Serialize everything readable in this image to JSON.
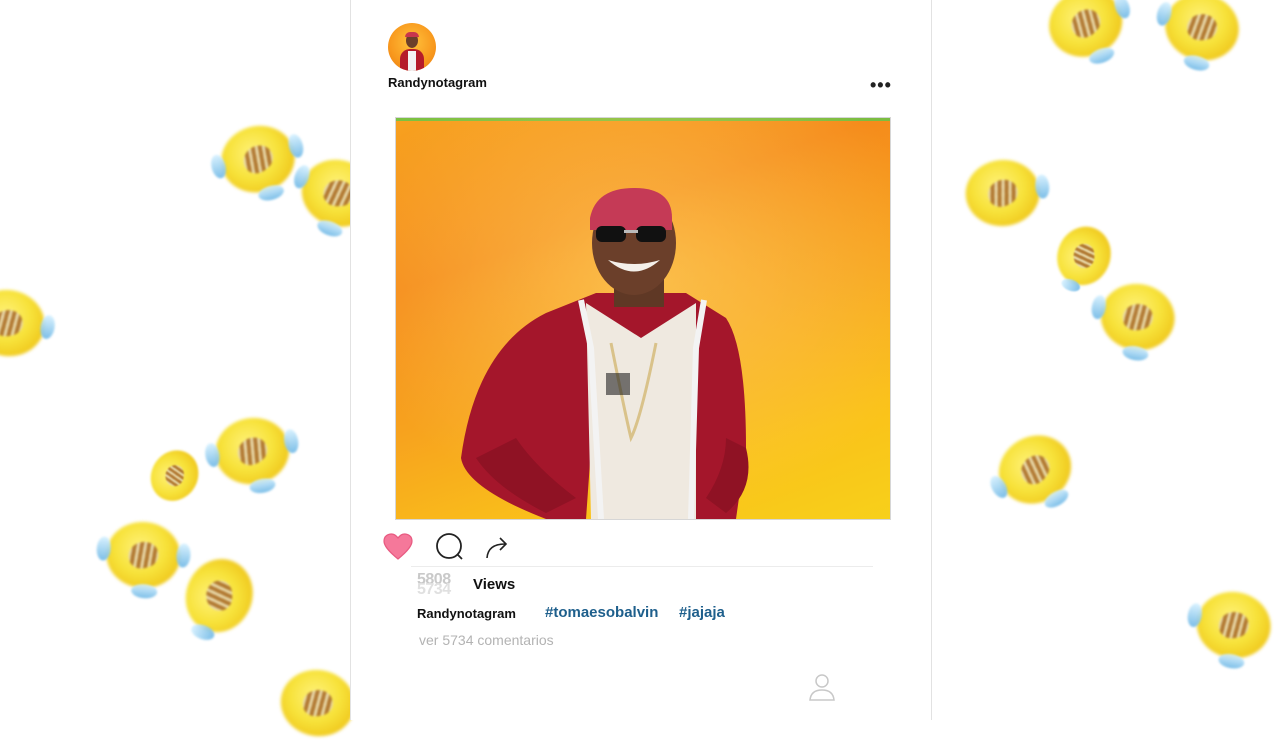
{
  "post": {
    "username": "Randynotagram",
    "more_label": "•••",
    "views_count": "5808",
    "views_count_ghost": "5734",
    "views_label": "Views",
    "caption_user": "Randynotagram",
    "hashtags": [
      "#tomaesobalvin",
      "#jajaja"
    ],
    "comments_link": "ver 5734 comentarios",
    "liked": true
  },
  "colors": {
    "accent_link": "#1e5f8c",
    "heart": "#f06b8d",
    "background_emoji": "#f7e23a"
  },
  "icons": [
    "heart-icon",
    "comment-icon",
    "share-icon",
    "profile-icon",
    "more-icon"
  ]
}
